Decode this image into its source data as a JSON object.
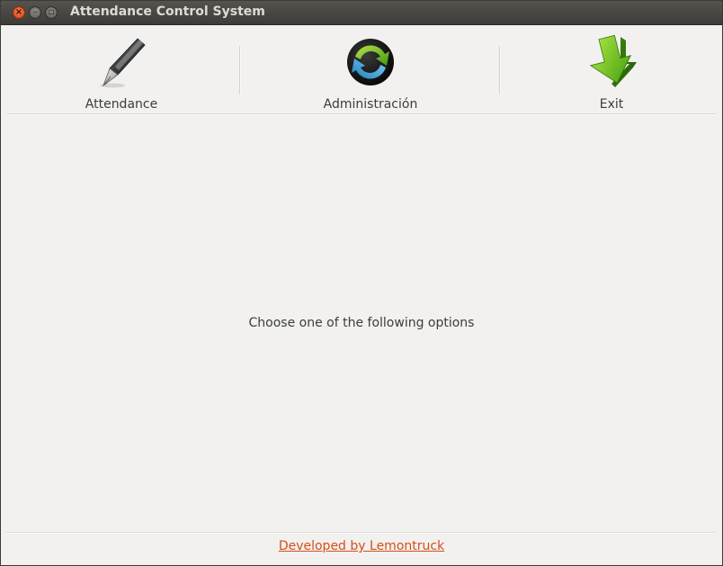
{
  "window": {
    "title": "Attendance Control System",
    "close_glyph": "×",
    "minimize_glyph": "–",
    "maximize_glyph": "▫"
  },
  "toolbar": {
    "items": [
      {
        "label": "Attendance",
        "icon": "pen-icon"
      },
      {
        "label": "Administración",
        "icon": "sync-arrows-icon"
      },
      {
        "label": "Exit",
        "icon": "down-arrow-exit-icon"
      }
    ]
  },
  "main": {
    "prompt": "Choose one of the following options"
  },
  "footer": {
    "link_text": "Developed by Lemontruck"
  },
  "colors": {
    "titlebar": "#3c3b37",
    "window_bg": "#f2f1f0",
    "close_button": "#e9541f",
    "link": "#d64e17",
    "exit_arrow_green": "#5fb818"
  }
}
